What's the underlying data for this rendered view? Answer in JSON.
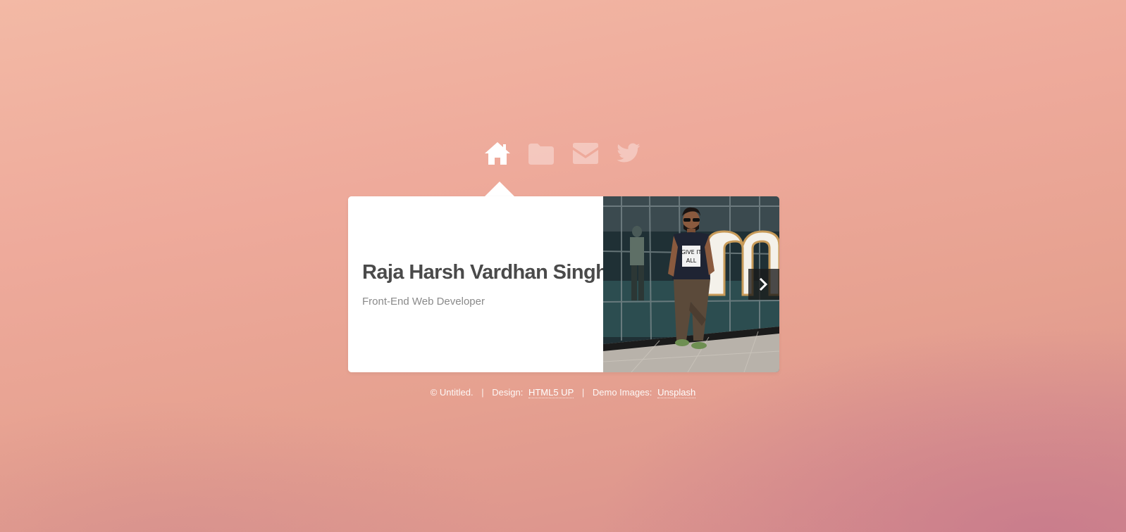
{
  "nav": {
    "items": [
      {
        "icon": "home-icon",
        "label": "Home",
        "active": true
      },
      {
        "icon": "folder-icon",
        "label": "Portfolio",
        "active": false
      },
      {
        "icon": "envelope-icon",
        "label": "Contact",
        "active": false
      },
      {
        "icon": "twitter-icon",
        "label": "Twitter",
        "active": false
      }
    ]
  },
  "intro": {
    "name": "Raja Harsh Vardhan Singh",
    "role": "Front-End Web Developer"
  },
  "photo": {
    "next_icon": "chevron-right-icon",
    "shirt_text": "GIVE IT ALL"
  },
  "footer": {
    "copyright": "© Untitled.",
    "separator": "|",
    "design_label": "Design:",
    "design_link": "HTML5 UP",
    "images_label": "Demo Images:",
    "images_link": "Unsplash"
  },
  "colors": {
    "panel_background": "#ffffff",
    "name_text": "#4a4a4a",
    "role_text": "#8a8a8a",
    "nav_active": "#ffffff",
    "nav_inactive": "rgba(255,255,255,0.35)"
  }
}
